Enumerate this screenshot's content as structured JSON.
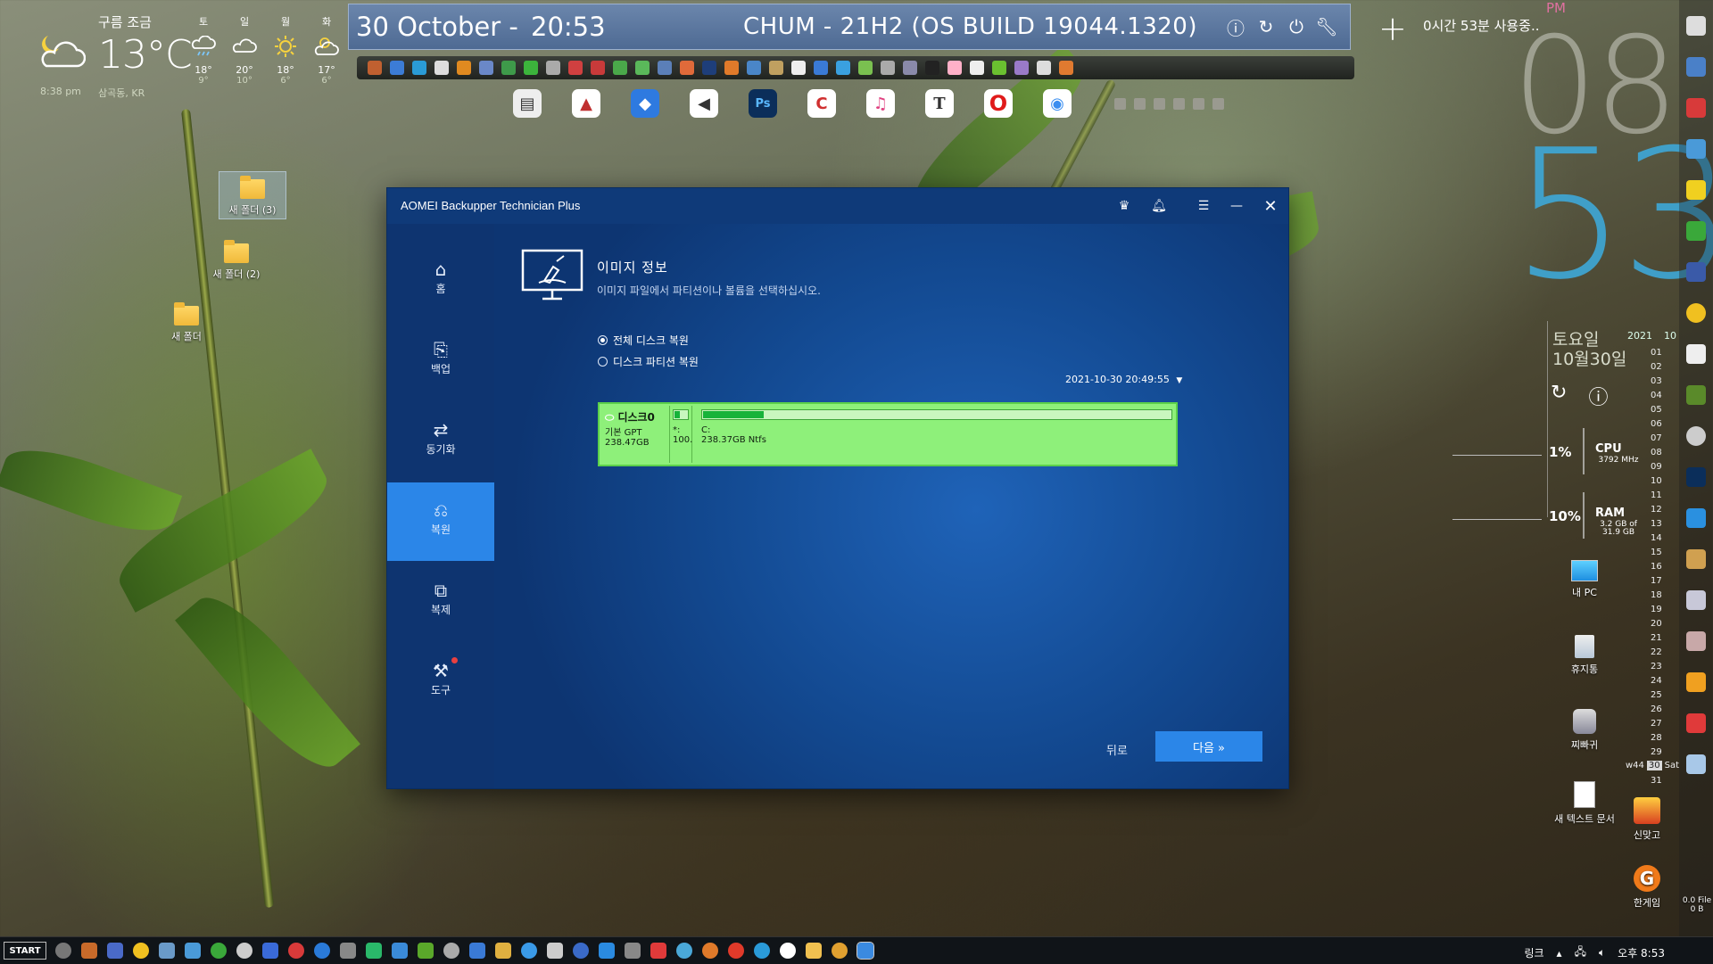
{
  "weather": {
    "condition": "구름 조금",
    "temperature": "13°C",
    "updated_time": "8:38 pm",
    "location": "삼곡동, KR",
    "forecast": [
      {
        "day": "토",
        "high": "18°",
        "low": "9°",
        "icon": "rain-cloud-icon"
      },
      {
        "day": "일",
        "high": "20°",
        "low": "10°",
        "icon": "cloud-icon"
      },
      {
        "day": "월",
        "high": "18°",
        "low": "6°",
        "icon": "sun-icon"
      },
      {
        "day": "화",
        "high": "17°",
        "low": "6°",
        "icon": "partly-sunny-icon"
      }
    ]
  },
  "statusbar": {
    "date": "30 October -",
    "time": "20:53",
    "os_info": "CHUM - 21H2 (OS BUILD 19044.1320)"
  },
  "timer": {
    "text": "0시간 53분 사용중.."
  },
  "bigclock": {
    "ampm": "PM",
    "hours": "08",
    "minutes": "53"
  },
  "calendar": {
    "day_of_week": "토요일",
    "month_day": "10월30일",
    "year": "2021",
    "month": "10",
    "days": [
      "01",
      "02",
      "03",
      "04",
      "05",
      "06",
      "07",
      "08",
      "09",
      "10",
      "11",
      "12",
      "13",
      "14",
      "15",
      "16",
      "17",
      "18",
      "19",
      "20",
      "21",
      "22",
      "23",
      "24",
      "25",
      "26",
      "27",
      "28",
      "29"
    ],
    "week": "w44",
    "today": "30",
    "today_dow": "Sat",
    "last_day": "31"
  },
  "sysmon": {
    "cpu": {
      "percent": "1%",
      "label": "CPU",
      "sub": "3792 MHz"
    },
    "ram": {
      "percent": "10%",
      "label": "RAM",
      "sub": "3.2 GB of 31.9 GB"
    }
  },
  "desktop_icons": [
    {
      "label": "새 폴더 (3)"
    },
    {
      "label": "새 폴더 (2)"
    },
    {
      "label": "새 폴더"
    },
    {
      "label": "내 PC"
    },
    {
      "label": "휴지통"
    },
    {
      "label": "찌빠귀"
    },
    {
      "label": "새 텍스트 문서"
    },
    {
      "label": "신맞고"
    },
    {
      "label": "한게임"
    },
    {
      "label": "0.0 File 0 B"
    }
  ],
  "app": {
    "title": "AOMEI Backupper Technician Plus",
    "nav": [
      {
        "label": "홈"
      },
      {
        "label": "백업"
      },
      {
        "label": "동기화"
      },
      {
        "label": "복원"
      },
      {
        "label": "복제"
      },
      {
        "label": "도구"
      }
    ],
    "section_title": "이미지 정보",
    "section_desc": "이미지 파일에서 파티션이나 볼륨을 선택하십시오.",
    "radio_full": "전체 디스크 복원",
    "radio_partition": "디스크 파티션 복원",
    "image_date": "2021-10-30 20:49:55",
    "disk": {
      "name": "디스크0",
      "type": "기본 GPT",
      "size": "238.47GB",
      "part1_name": "*:",
      "part1_size": "100.",
      "part2_name": "C:",
      "part2_info": "238.37GB Ntfs",
      "part1_used_fraction": 0.35,
      "part2_used_fraction": 0.13
    },
    "back_label": "뒤로",
    "next_label": "다음 »"
  },
  "taskbar": {
    "start_label": "START",
    "links_label": "링크",
    "clock": "오후 8:53"
  },
  "colors": {
    "window_bg": "#134a92",
    "sidebar_bg": "#0e3470",
    "accent": "#2b86e8",
    "disk_green": "#8ef07a",
    "topbar": "#5a77a0",
    "minutes_blue": "#3ea8d8"
  }
}
